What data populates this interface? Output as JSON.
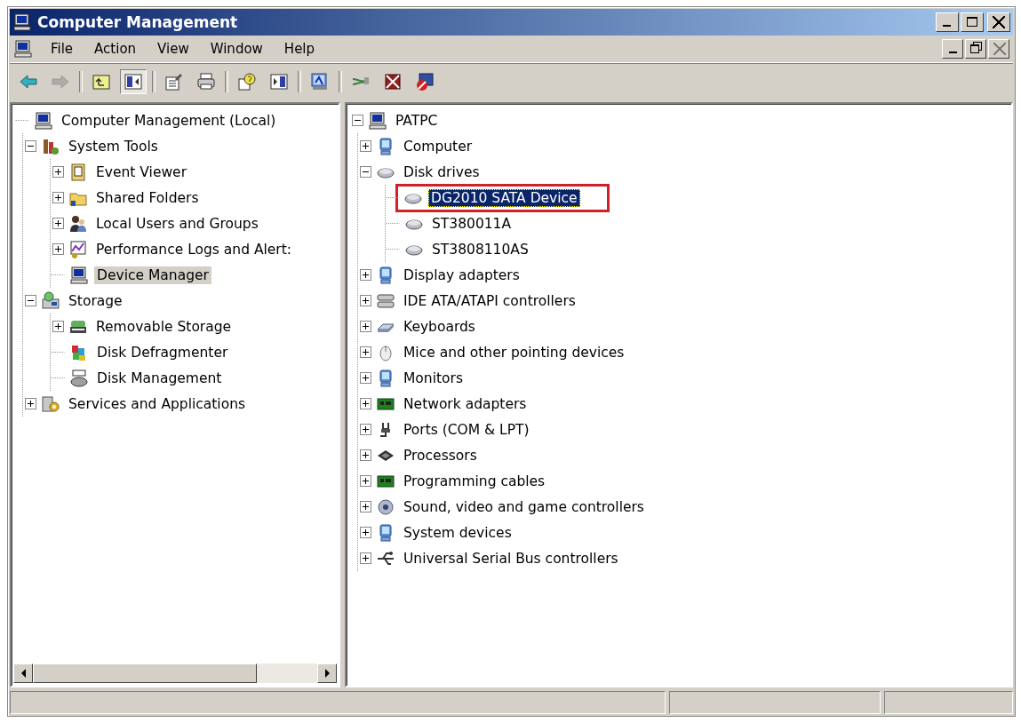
{
  "window": {
    "title": "Computer Management"
  },
  "menu": [
    {
      "label": "File"
    },
    {
      "label": "Action"
    },
    {
      "label": "View"
    },
    {
      "label": "Window"
    },
    {
      "label": "Help"
    }
  ],
  "toolbar": [
    [
      {
        "kind": "back",
        "disabled": false,
        "pressed": false
      },
      {
        "kind": "forward",
        "disabled": true,
        "pressed": false
      }
    ],
    [
      {
        "kind": "up",
        "disabled": false,
        "pressed": false
      },
      {
        "kind": "tree",
        "disabled": false,
        "pressed": true
      }
    ],
    [
      {
        "kind": "properties",
        "disabled": false,
        "pressed": false
      },
      {
        "kind": "print",
        "disabled": false,
        "pressed": false
      }
    ],
    [
      {
        "kind": "help",
        "disabled": false,
        "pressed": false
      },
      {
        "kind": "actionpane",
        "disabled": false,
        "pressed": false
      }
    ],
    [
      {
        "kind": "scan",
        "disabled": false,
        "pressed": false
      }
    ],
    [
      {
        "kind": "cable",
        "disabled": false,
        "pressed": false
      },
      {
        "kind": "uninstall",
        "disabled": false,
        "pressed": false
      },
      {
        "kind": "disable",
        "disabled": false,
        "pressed": false
      }
    ]
  ],
  "left_tree": {
    "focused": false,
    "nodes": [
      {
        "label": "Computer Management (Local)",
        "kind": "computer",
        "selected": false,
        "children": [
          {
            "label": "System Tools",
            "kind": "tools",
            "selected": false,
            "expanded": true,
            "children": [
              {
                "label": "Event Viewer",
                "kind": "log",
                "selected": false,
                "expanded": false
              },
              {
                "label": "Shared Folders",
                "kind": "folder",
                "selected": false,
                "expanded": false
              },
              {
                "label": "Local Users and Groups",
                "kind": "users",
                "selected": false,
                "expanded": false
              },
              {
                "label": "Performance Logs and Alert:",
                "kind": "chart",
                "selected": false,
                "expanded": false
              },
              {
                "label": "Device Manager",
                "kind": "computer",
                "selected": true
              }
            ]
          },
          {
            "label": "Storage",
            "kind": "storage",
            "selected": false,
            "expanded": true,
            "children": [
              {
                "label": "Removable Storage",
                "kind": "removable",
                "selected": false,
                "expanded": false
              },
              {
                "label": "Disk Defragmenter",
                "kind": "defrag",
                "selected": false
              },
              {
                "label": "Disk Management",
                "kind": "diskmgmt",
                "selected": false
              }
            ]
          },
          {
            "label": "Services and Applications",
            "kind": "services",
            "selected": false,
            "expanded": false
          }
        ]
      }
    ]
  },
  "right_tree": {
    "focused": true,
    "nodes": [
      {
        "label": "PATPC",
        "kind": "computer",
        "selected": false,
        "expanded": true,
        "children": [
          {
            "label": "Computer",
            "kind": "monitor",
            "selected": false,
            "expanded": false
          },
          {
            "label": "Disk drives",
            "kind": "drive",
            "selected": false,
            "expanded": true,
            "children": [
              {
                "label": "DG2010 SATA Device",
                "kind": "drive",
                "selected": true,
                "annotated": true
              },
              {
                "label": "ST380011A",
                "kind": "drive",
                "selected": false
              },
              {
                "label": "ST3808110AS",
                "kind": "drive",
                "selected": false
              }
            ]
          },
          {
            "label": "Display adapters",
            "kind": "monitor",
            "selected": false,
            "expanded": false
          },
          {
            "label": "IDE ATA/ATAPI controllers",
            "kind": "controller",
            "selected": false,
            "expanded": false
          },
          {
            "label": "Keyboards",
            "kind": "keyboard",
            "selected": false,
            "expanded": false
          },
          {
            "label": "Mice and other pointing devices",
            "kind": "mouse",
            "selected": false,
            "expanded": false
          },
          {
            "label": "Monitors",
            "kind": "monitor",
            "selected": false,
            "expanded": false
          },
          {
            "label": "Network adapters",
            "kind": "board",
            "selected": false,
            "expanded": false
          },
          {
            "label": "Ports (COM & LPT)",
            "kind": "port",
            "selected": false,
            "expanded": false
          },
          {
            "label": "Processors",
            "kind": "chip",
            "selected": false,
            "expanded": false
          },
          {
            "label": "Programming cables",
            "kind": "board",
            "selected": false,
            "expanded": false
          },
          {
            "label": "Sound, video and game controllers",
            "kind": "sound",
            "selected": false,
            "expanded": false
          },
          {
            "label": "System devices",
            "kind": "monitor",
            "selected": false,
            "expanded": false
          },
          {
            "label": "Universal Serial Bus controllers",
            "kind": "usb",
            "selected": false,
            "expanded": false
          }
        ]
      }
    ]
  }
}
